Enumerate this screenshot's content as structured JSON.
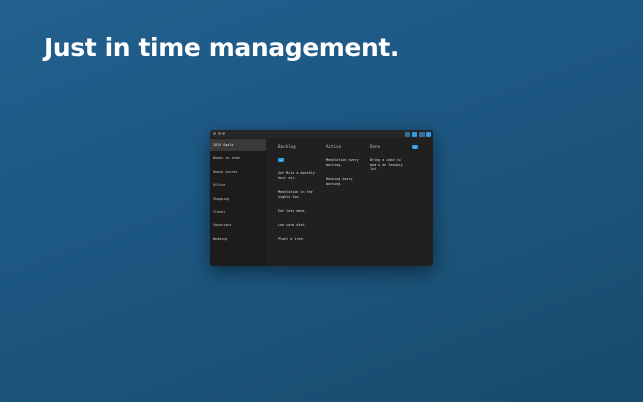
{
  "headline": "Just in time management.",
  "toolbar": {
    "buttons": [
      "",
      "",
      "",
      ""
    ]
  },
  "sidebar": {
    "items": [
      {
        "label": "2019 Goals"
      },
      {
        "label": "Books to read"
      },
      {
        "label": "House chores"
      },
      {
        "label": "Office"
      },
      {
        "label": "Shopping"
      },
      {
        "label": "Travel"
      },
      {
        "label": "Vacations"
      },
      {
        "label": "Wedding"
      }
    ]
  },
  "board": {
    "columns": [
      {
        "title": "Backlog",
        "cards": [
          "Get Milo a monthly hair cut.",
          "Meditation in the nights too.",
          "Eat less meat.",
          "Low carb diet.",
          "Plant a tree."
        ]
      },
      {
        "title": "Active",
        "cards": [
          "Meditation every morning.",
          "Running every morning."
        ]
      },
      {
        "title": "Done",
        "cards": [
          "Bring a cake to mom's on January 1st."
        ]
      }
    ],
    "add_label": "+"
  },
  "colors": {
    "accent": "#2f9ee8",
    "window_bg": "#202020",
    "sidebar_bg": "#1c1c1c"
  }
}
